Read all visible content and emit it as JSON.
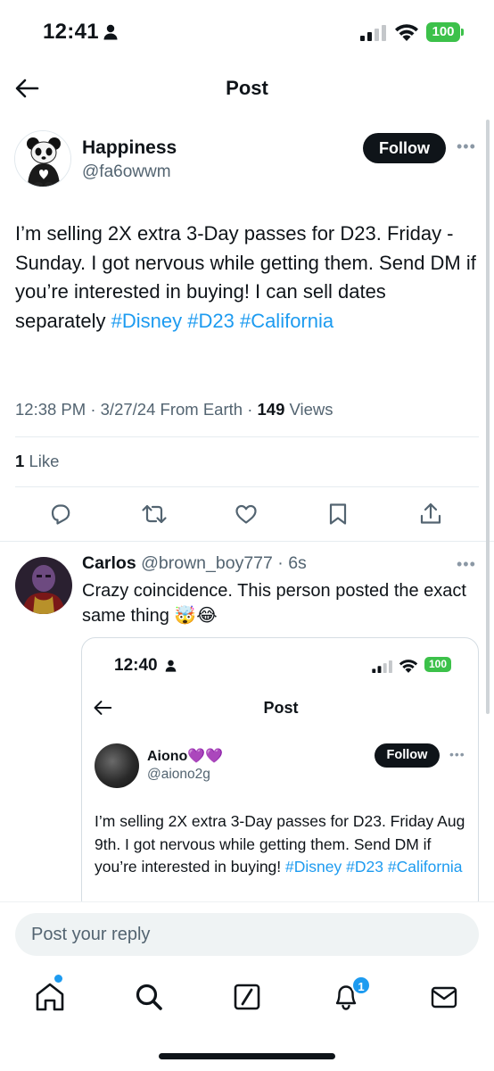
{
  "status_bar": {
    "time": "12:41",
    "battery": "100"
  },
  "header": {
    "title": "Post"
  },
  "post": {
    "author_name": "Happiness",
    "author_handle": "@fa6owwm",
    "follow_label": "Follow",
    "text_plain": "I’m selling 2X extra 3-Day passes for D23. Friday - Sunday. I got nervous while getting them. Send  DM if you’re interested in buying! I can sell dates separately ",
    "hashtags": [
      "#Disney",
      "#D23",
      "#California"
    ],
    "time": "12:38 PM",
    "date": "3/27/24",
    "location": "From Earth",
    "views_count": "149",
    "views_label": "Views",
    "likes_count": "1",
    "likes_label": "Like"
  },
  "reply": {
    "name": "Carlos",
    "handle": "@brown_boy777",
    "age": "6s",
    "text": "Crazy coincidence. This person posted the exact same thing 🤯😂"
  },
  "embedded_screenshot": {
    "time": "12:40",
    "battery": "100",
    "title": "Post",
    "author_name": "Aiono💜💜",
    "author_handle": "@aiono2g",
    "follow_label": "Follow",
    "text_plain": "I’m selling 2X extra 3-Day passes for D23. Friday Aug 9th. I got nervous while getting them. Send  DM if you’re interested in buying! ",
    "hashtags": [
      "#Disney",
      "#D23",
      "#California"
    ]
  },
  "composer": {
    "placeholder": "Post your reply"
  },
  "bottom_nav": {
    "items": [
      "home-icon",
      "search-icon",
      "grok-icon",
      "notifications-icon",
      "messages-icon"
    ],
    "notification_count": "1"
  },
  "colors": {
    "accent": "#1d9bf0",
    "text": "#0f1419",
    "secondary": "#536471",
    "battery": "#3cc14a"
  }
}
